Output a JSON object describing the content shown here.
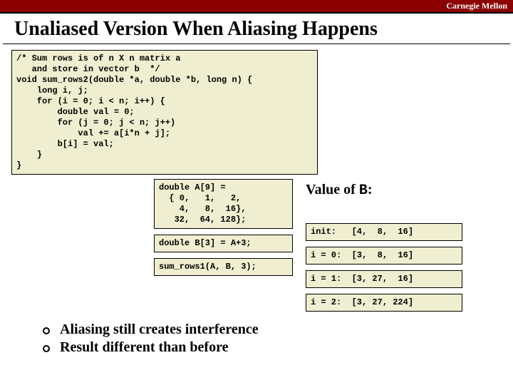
{
  "brand": "Carnegie Mellon",
  "title": "Unaliased Version When Aliasing Happens",
  "main_code": "/* Sum rows is of n X n matrix a\n   and store in vector b  */\nvoid sum_rows2(double *a, double *b, long n) {\n    long i, j;\n    for (i = 0; i < n; i++) {\n        double val = 0;\n        for (j = 0; j < n; j++)\n            val += a[i*n + j];\n        b[i] = val;\n    }\n}",
  "value_label": "Value of ",
  "value_var": "B",
  "value_colon": ":",
  "snippets": {
    "decl": "double A[9] =\n  { 0,   1,   2,\n    4,   8,  16},\n   32,  64, 128};",
    "alias": "double B[3] = A+3;",
    "call": "sum_rows1(A, B, 3);"
  },
  "trace": {
    "init": "init:   [4,  8,  16]",
    "i0": "i = 0:  [3,  8,  16]",
    "i1": "i = 1:  [3, 27,  16]",
    "i2": "i = 2:  [3, 27, 224]"
  },
  "bullets": {
    "a": "Aliasing still creates interference",
    "b": "Result different than before"
  }
}
